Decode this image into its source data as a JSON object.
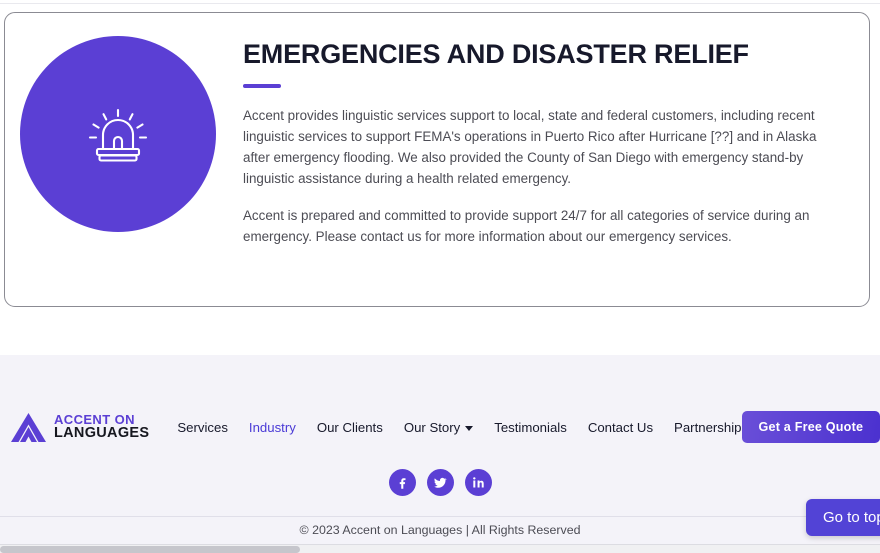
{
  "hero": {
    "icon": "emergency-siren-icon",
    "title": "EMERGENCIES AND DISASTER RELIEF",
    "paragraphs": [
      "Accent provides linguistic services support to local, state and federal customers, including recent linguistic services to support FEMA's operations in Puerto Rico after Hurricane [??] and in Alaska after emergency flooding. We also provided the County of San Diego with emergency stand-by linguistic assistance during a health related emergency.",
      "Accent is prepared and committed to provide support 24/7 for all categories of service during an emergency. Please contact us for more information about our emergency services."
    ]
  },
  "footer": {
    "logo": {
      "icon": "accent-triangle-logo-icon",
      "line1": "ACCENT ON",
      "line2": "LANGUAGES"
    },
    "nav": [
      {
        "label": "Services",
        "active": false,
        "dropdown": false
      },
      {
        "label": "Industry",
        "active": true,
        "dropdown": false
      },
      {
        "label": "Our Clients",
        "active": false,
        "dropdown": false
      },
      {
        "label": "Our Story",
        "active": false,
        "dropdown": true
      },
      {
        "label": "Testimonials",
        "active": false,
        "dropdown": false
      },
      {
        "label": "Contact Us",
        "active": false,
        "dropdown": false
      },
      {
        "label": "Partnership",
        "active": false,
        "dropdown": false
      }
    ],
    "quote_button": "Get a Free Quote",
    "socials": [
      {
        "name": "facebook-icon",
        "label": "Facebook"
      },
      {
        "name": "twitter-icon",
        "label": "Twitter"
      },
      {
        "name": "linkedin-icon",
        "label": "LinkedIn"
      }
    ],
    "copyright": "© 2023 Accent on Languages | All Rights Reserved"
  },
  "floating": {
    "goto_top_label": "Go to top"
  },
  "colors": {
    "purple": "#5b3fd4",
    "purple_link": "#4a3ad6",
    "heading": "#17192b",
    "body_text": "#4c4c54",
    "footer_bg": "#f4f3f9"
  }
}
